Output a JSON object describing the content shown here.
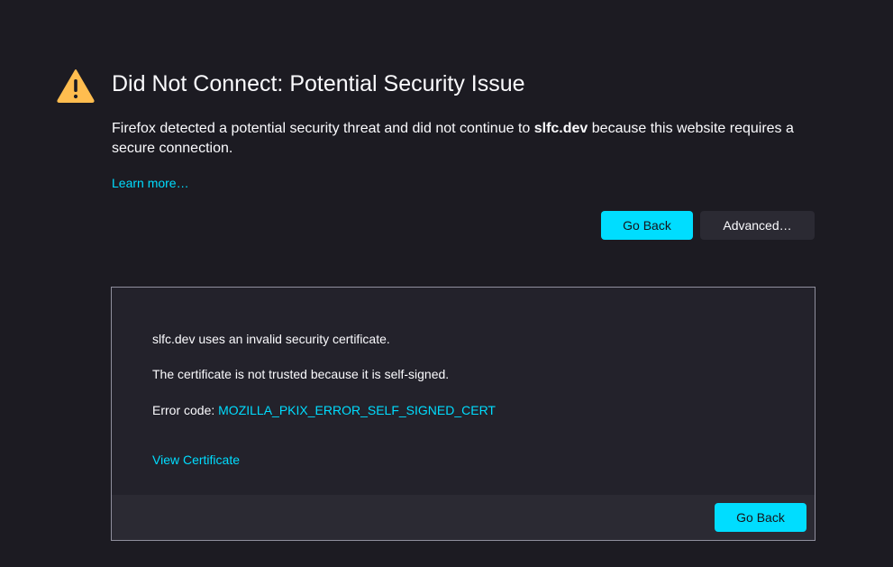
{
  "error_page": {
    "title": "Did Not Connect: Potential Security Issue",
    "description": {
      "before": "Firefox detected a potential security threat and did not continue to ",
      "host": "slfc.dev",
      "after": " because this website requires a secure connection."
    },
    "learn_more": "Learn more…",
    "go_back_label": "Go Back",
    "advanced_label": "Advanced…",
    "icon": "warning-triangle-icon",
    "accent_color": "#00ddff",
    "warning_color": "#ffbd4f"
  },
  "advanced_panel": {
    "invalid_cert_text": "slfc.dev uses an invalid security certificate.",
    "reason_text": "The certificate is not trusted because it is self-signed.",
    "error_code_label": "Error code: ",
    "error_code": "MOZILLA_PKIX_ERROR_SELF_SIGNED_CERT",
    "view_certificate": "View Certificate",
    "go_back_label": "Go Back"
  }
}
